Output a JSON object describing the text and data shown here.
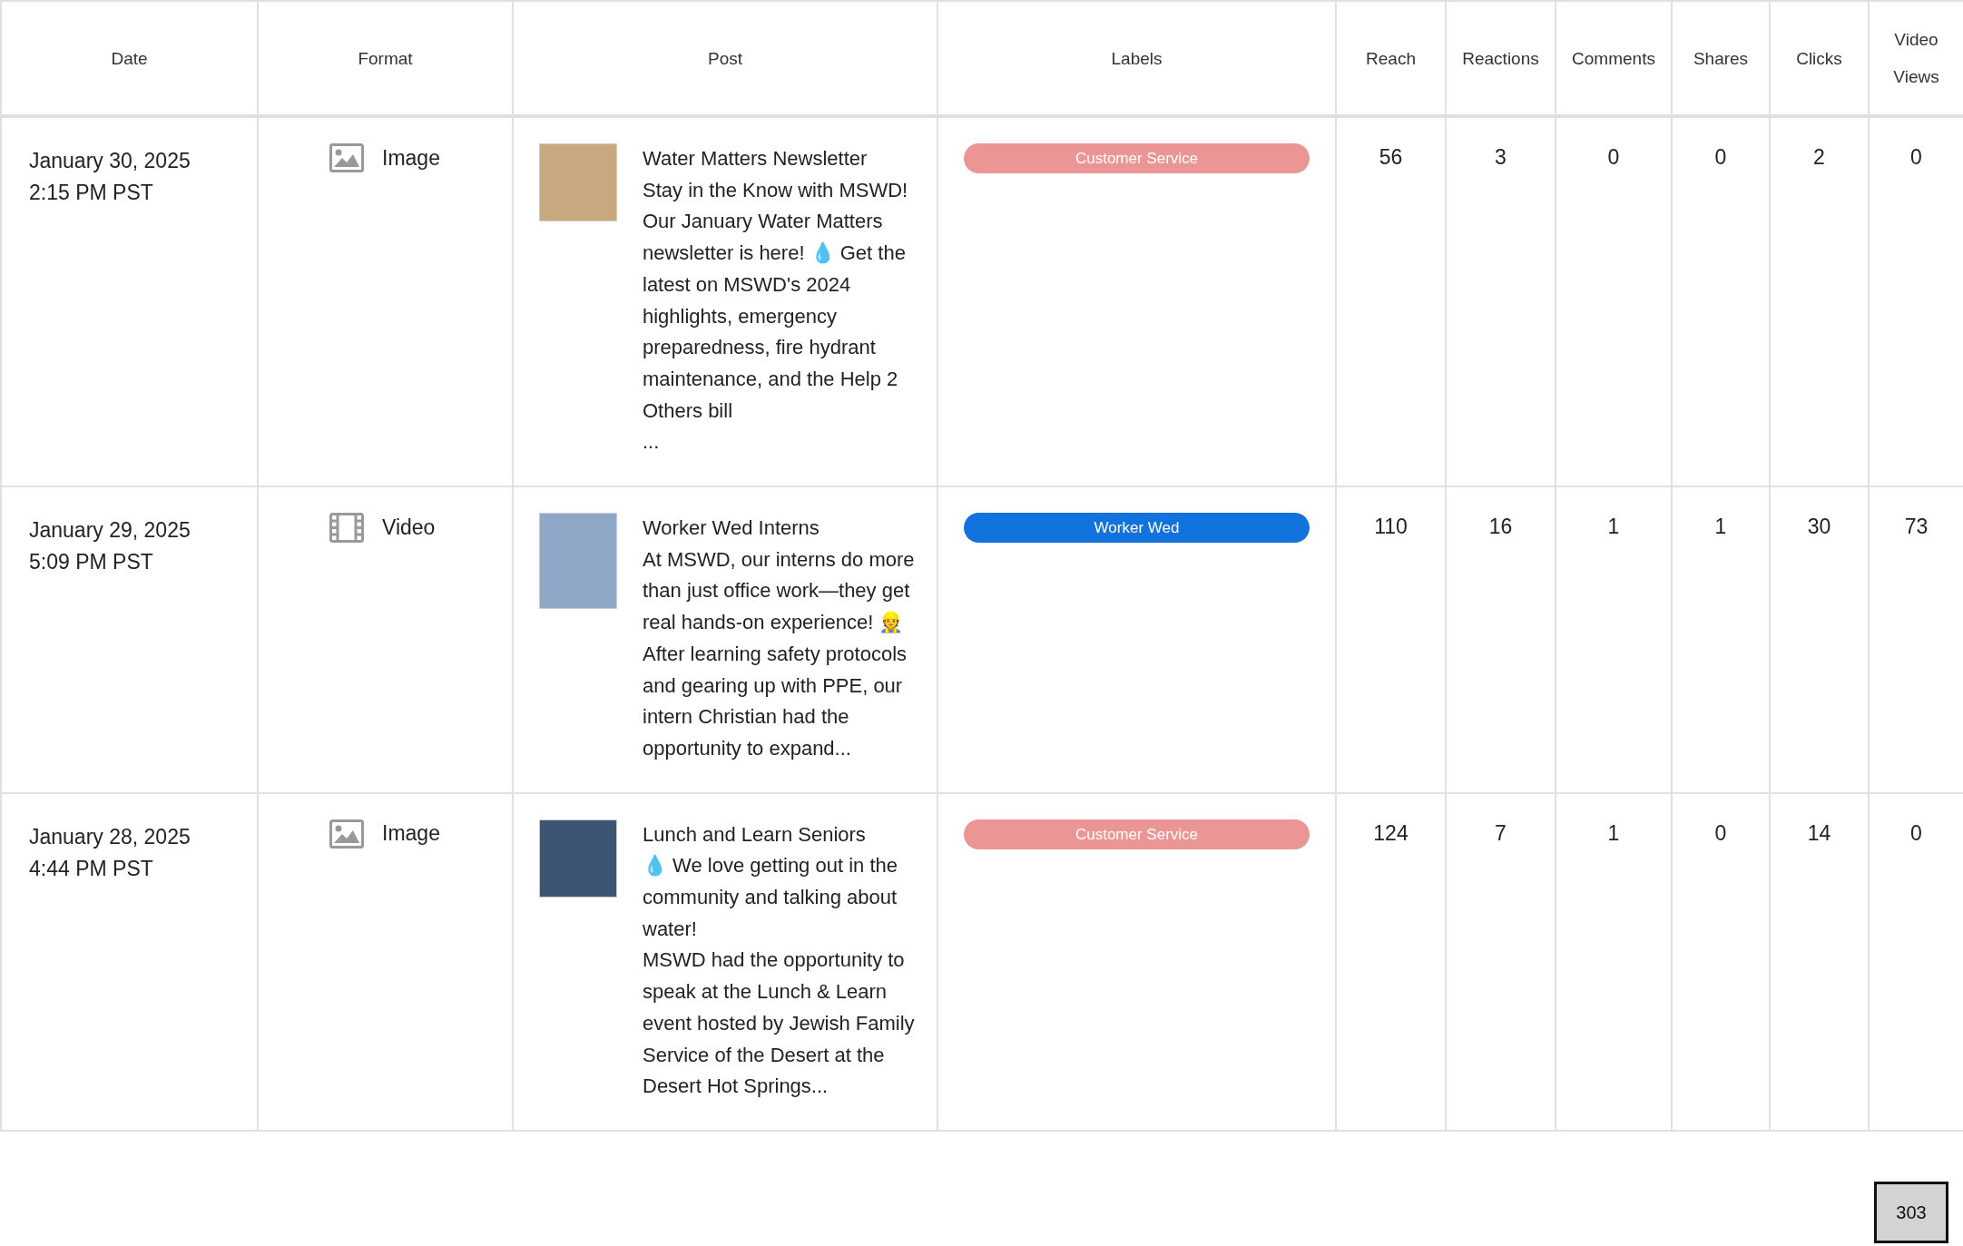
{
  "table": {
    "columns": [
      "Date",
      "Format",
      "Post",
      "Labels",
      "Reach",
      "Reactions",
      "Comments",
      "Shares",
      "Clicks",
      "Video Views"
    ],
    "rows": [
      {
        "date": "January 30, 2025",
        "time": "2:15 PM PST",
        "format": {
          "kind": "image",
          "label": "Image"
        },
        "post": "Water Matters Newsletter\nStay in the Know with MSWD!\nOur January Water Matters newsletter is here! 💧 Get the latest on MSWD's 2024 highlights, emergency preparedness, fire hydrant maintenance, and the Help 2 Others bill\n...",
        "label": {
          "text": "Customer Service",
          "color": "#eb9694"
        },
        "metrics": [
          "56",
          "3",
          "0",
          "0",
          "2",
          "0"
        ]
      },
      {
        "date": "January 29, 2025",
        "time": "5:09 PM PST",
        "format": {
          "kind": "video",
          "label": "Video"
        },
        "post": "Worker Wed Interns\nAt MSWD, our interns do more than just office work—they get real hands-on experience! 👷After learning safety protocols and gearing up with PPE, our intern Christian had the opportunity to expand...",
        "label": {
          "text": "Worker Wed",
          "color": "#1273de"
        },
        "metrics": [
          "110",
          "16",
          "1",
          "1",
          "30",
          "73"
        ]
      },
      {
        "date": "January 28, 2025",
        "time": "4:44 PM PST",
        "format": {
          "kind": "image",
          "label": "Image"
        },
        "post": "Lunch and Learn Seniors\n💧 We love getting out in the community and talking about water!\nMSWD had the opportunity to speak at the Lunch & Learn event hosted by Jewish Family Service of the Desert at the Desert Hot Springs...",
        "label": {
          "text": "Customer Service",
          "color": "#eb9694"
        },
        "metrics": [
          "124",
          "7",
          "1",
          "0",
          "14",
          "0"
        ]
      }
    ]
  },
  "counter": "303"
}
